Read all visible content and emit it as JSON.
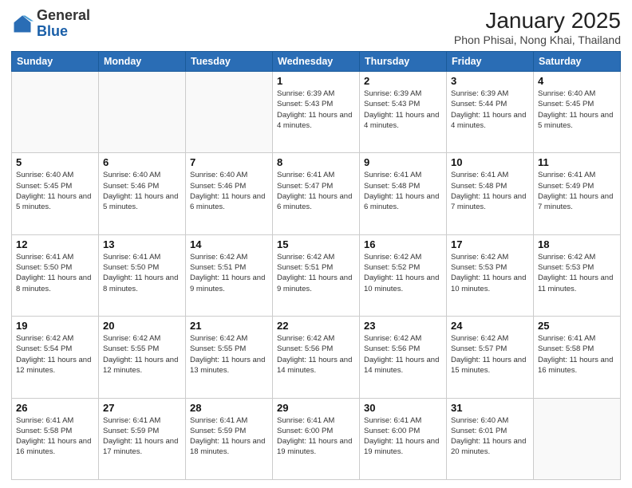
{
  "header": {
    "logo_general": "General",
    "logo_blue": "Blue",
    "month_title": "January 2025",
    "location": "Phon Phisai, Nong Khai, Thailand"
  },
  "weekdays": [
    "Sunday",
    "Monday",
    "Tuesday",
    "Wednesday",
    "Thursday",
    "Friday",
    "Saturday"
  ],
  "weeks": [
    [
      {
        "day": "",
        "sunrise": "",
        "sunset": "",
        "daylight": ""
      },
      {
        "day": "",
        "sunrise": "",
        "sunset": "",
        "daylight": ""
      },
      {
        "day": "",
        "sunrise": "",
        "sunset": "",
        "daylight": ""
      },
      {
        "day": "1",
        "sunrise": "Sunrise: 6:39 AM",
        "sunset": "Sunset: 5:43 PM",
        "daylight": "Daylight: 11 hours and 4 minutes."
      },
      {
        "day": "2",
        "sunrise": "Sunrise: 6:39 AM",
        "sunset": "Sunset: 5:43 PM",
        "daylight": "Daylight: 11 hours and 4 minutes."
      },
      {
        "day": "3",
        "sunrise": "Sunrise: 6:39 AM",
        "sunset": "Sunset: 5:44 PM",
        "daylight": "Daylight: 11 hours and 4 minutes."
      },
      {
        "day": "4",
        "sunrise": "Sunrise: 6:40 AM",
        "sunset": "Sunset: 5:45 PM",
        "daylight": "Daylight: 11 hours and 5 minutes."
      }
    ],
    [
      {
        "day": "5",
        "sunrise": "Sunrise: 6:40 AM",
        "sunset": "Sunset: 5:45 PM",
        "daylight": "Daylight: 11 hours and 5 minutes."
      },
      {
        "day": "6",
        "sunrise": "Sunrise: 6:40 AM",
        "sunset": "Sunset: 5:46 PM",
        "daylight": "Daylight: 11 hours and 5 minutes."
      },
      {
        "day": "7",
        "sunrise": "Sunrise: 6:40 AM",
        "sunset": "Sunset: 5:46 PM",
        "daylight": "Daylight: 11 hours and 6 minutes."
      },
      {
        "day": "8",
        "sunrise": "Sunrise: 6:41 AM",
        "sunset": "Sunset: 5:47 PM",
        "daylight": "Daylight: 11 hours and 6 minutes."
      },
      {
        "day": "9",
        "sunrise": "Sunrise: 6:41 AM",
        "sunset": "Sunset: 5:48 PM",
        "daylight": "Daylight: 11 hours and 6 minutes."
      },
      {
        "day": "10",
        "sunrise": "Sunrise: 6:41 AM",
        "sunset": "Sunset: 5:48 PM",
        "daylight": "Daylight: 11 hours and 7 minutes."
      },
      {
        "day": "11",
        "sunrise": "Sunrise: 6:41 AM",
        "sunset": "Sunset: 5:49 PM",
        "daylight": "Daylight: 11 hours and 7 minutes."
      }
    ],
    [
      {
        "day": "12",
        "sunrise": "Sunrise: 6:41 AM",
        "sunset": "Sunset: 5:50 PM",
        "daylight": "Daylight: 11 hours and 8 minutes."
      },
      {
        "day": "13",
        "sunrise": "Sunrise: 6:41 AM",
        "sunset": "Sunset: 5:50 PM",
        "daylight": "Daylight: 11 hours and 8 minutes."
      },
      {
        "day": "14",
        "sunrise": "Sunrise: 6:42 AM",
        "sunset": "Sunset: 5:51 PM",
        "daylight": "Daylight: 11 hours and 9 minutes."
      },
      {
        "day": "15",
        "sunrise": "Sunrise: 6:42 AM",
        "sunset": "Sunset: 5:51 PM",
        "daylight": "Daylight: 11 hours and 9 minutes."
      },
      {
        "day": "16",
        "sunrise": "Sunrise: 6:42 AM",
        "sunset": "Sunset: 5:52 PM",
        "daylight": "Daylight: 11 hours and 10 minutes."
      },
      {
        "day": "17",
        "sunrise": "Sunrise: 6:42 AM",
        "sunset": "Sunset: 5:53 PM",
        "daylight": "Daylight: 11 hours and 10 minutes."
      },
      {
        "day": "18",
        "sunrise": "Sunrise: 6:42 AM",
        "sunset": "Sunset: 5:53 PM",
        "daylight": "Daylight: 11 hours and 11 minutes."
      }
    ],
    [
      {
        "day": "19",
        "sunrise": "Sunrise: 6:42 AM",
        "sunset": "Sunset: 5:54 PM",
        "daylight": "Daylight: 11 hours and 12 minutes."
      },
      {
        "day": "20",
        "sunrise": "Sunrise: 6:42 AM",
        "sunset": "Sunset: 5:55 PM",
        "daylight": "Daylight: 11 hours and 12 minutes."
      },
      {
        "day": "21",
        "sunrise": "Sunrise: 6:42 AM",
        "sunset": "Sunset: 5:55 PM",
        "daylight": "Daylight: 11 hours and 13 minutes."
      },
      {
        "day": "22",
        "sunrise": "Sunrise: 6:42 AM",
        "sunset": "Sunset: 5:56 PM",
        "daylight": "Daylight: 11 hours and 14 minutes."
      },
      {
        "day": "23",
        "sunrise": "Sunrise: 6:42 AM",
        "sunset": "Sunset: 5:56 PM",
        "daylight": "Daylight: 11 hours and 14 minutes."
      },
      {
        "day": "24",
        "sunrise": "Sunrise: 6:42 AM",
        "sunset": "Sunset: 5:57 PM",
        "daylight": "Daylight: 11 hours and 15 minutes."
      },
      {
        "day": "25",
        "sunrise": "Sunrise: 6:41 AM",
        "sunset": "Sunset: 5:58 PM",
        "daylight": "Daylight: 11 hours and 16 minutes."
      }
    ],
    [
      {
        "day": "26",
        "sunrise": "Sunrise: 6:41 AM",
        "sunset": "Sunset: 5:58 PM",
        "daylight": "Daylight: 11 hours and 16 minutes."
      },
      {
        "day": "27",
        "sunrise": "Sunrise: 6:41 AM",
        "sunset": "Sunset: 5:59 PM",
        "daylight": "Daylight: 11 hours and 17 minutes."
      },
      {
        "day": "28",
        "sunrise": "Sunrise: 6:41 AM",
        "sunset": "Sunset: 5:59 PM",
        "daylight": "Daylight: 11 hours and 18 minutes."
      },
      {
        "day": "29",
        "sunrise": "Sunrise: 6:41 AM",
        "sunset": "Sunset: 6:00 PM",
        "daylight": "Daylight: 11 hours and 19 minutes."
      },
      {
        "day": "30",
        "sunrise": "Sunrise: 6:41 AM",
        "sunset": "Sunset: 6:00 PM",
        "daylight": "Daylight: 11 hours and 19 minutes."
      },
      {
        "day": "31",
        "sunrise": "Sunrise: 6:40 AM",
        "sunset": "Sunset: 6:01 PM",
        "daylight": "Daylight: 11 hours and 20 minutes."
      },
      {
        "day": "",
        "sunrise": "",
        "sunset": "",
        "daylight": ""
      }
    ]
  ]
}
